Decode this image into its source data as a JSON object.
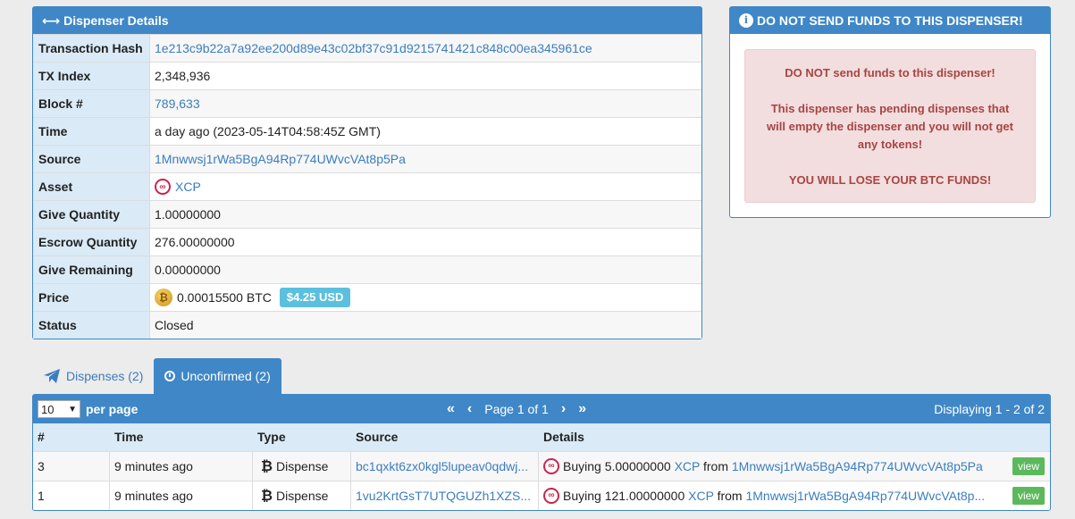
{
  "details": {
    "title": "Dispenser Details",
    "rows": [
      {
        "key": "Transaction Hash",
        "value": "1e213c9b22a7a92ee200d89e43c02bf37c91d9215741421c848c00ea345961ce"
      },
      {
        "key": "TX Index",
        "value": "2,348,936"
      },
      {
        "key": "Block #",
        "value": "789,633"
      },
      {
        "key": "Time",
        "value": "a day ago (2023-05-14T04:58:45Z GMT)"
      },
      {
        "key": "Source",
        "value": "1Mnwwsj1rWa5BgA94Rp774UWvcVAt8p5Pa"
      },
      {
        "key": "Asset",
        "value": "XCP"
      },
      {
        "key": "Give Quantity",
        "value": "1.00000000"
      },
      {
        "key": "Escrow Quantity",
        "value": "276.00000000"
      },
      {
        "key": "Give Remaining",
        "value": "0.00000000"
      },
      {
        "key": "Price",
        "value": "0.00015500 BTC",
        "usd": "$4.25 USD"
      },
      {
        "key": "Status",
        "value": "Closed"
      }
    ]
  },
  "warning": {
    "title": "DO NOT SEND FUNDS TO THIS DISPENSER!",
    "line1": "DO NOT send funds to this dispenser!",
    "line2": "This dispenser has pending dispenses that will empty the dispenser and you will not get any tokens!",
    "line3": "YOU WILL LOSE YOUR BTC FUNDS!"
  },
  "tabs": [
    {
      "label": "Dispenses (2)",
      "icon": "paper-plane-icon",
      "active": false
    },
    {
      "label": "Unconfirmed (2)",
      "icon": "clock-icon",
      "active": true
    }
  ],
  "list": {
    "per_page_value": "10",
    "per_page_label": "per page",
    "page_text": "Page 1 of 1",
    "displaying": "Displaying 1 - 2 of 2",
    "columns": [
      "#",
      "Time",
      "Type",
      "Source",
      "Details"
    ],
    "rows": [
      {
        "num": "3",
        "time": "9 minutes ago",
        "type": "Dispense",
        "source": "bc1qxkt6zx0kgl5lupeav0qdwj...",
        "buying": "Buying 5.00000000",
        "asset": "XCP",
        "from": "from",
        "address": "1Mnwwsj1rWa5BgA94Rp774UWvcVAt8p5Pa",
        "view": "view"
      },
      {
        "num": "1",
        "time": "9 minutes ago",
        "type": "Dispense",
        "source": "1vu2KrtGsT7UTQGUZh1XZS...",
        "buying": "Buying 121.00000000",
        "asset": "XCP",
        "from": "from",
        "address": "1Mnwwsj1rWa5BgA94Rp774UWvcVAt8p...",
        "view": "view"
      }
    ]
  },
  "colors": {
    "header": "#3f87c7",
    "link": "#3a7dbf",
    "warning_text": "#a94442",
    "usd_badge": "#5bc0de",
    "view_button": "#5cb85c"
  }
}
